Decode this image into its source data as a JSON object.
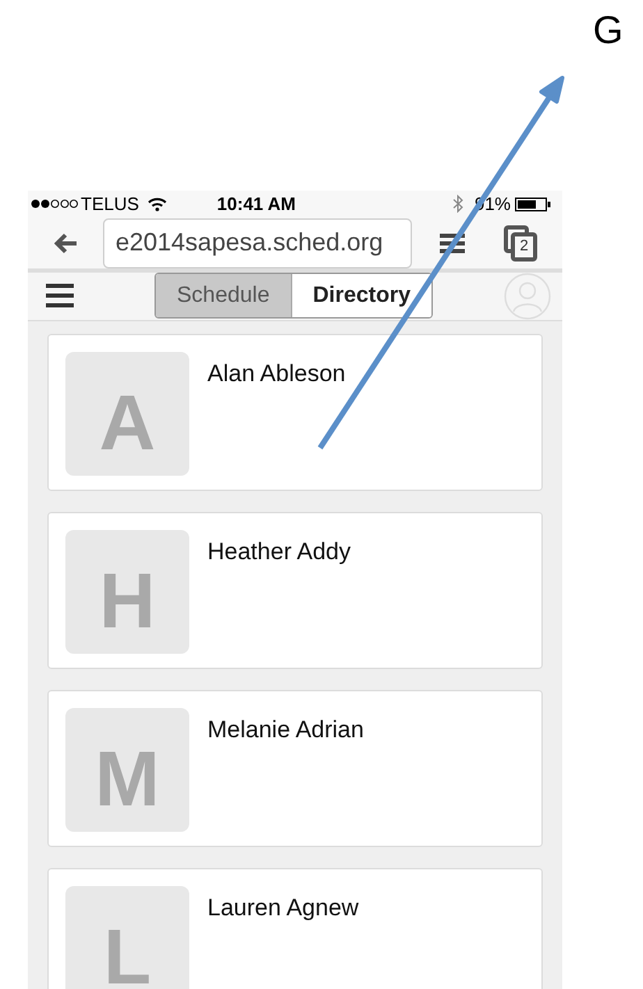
{
  "annotation": {
    "label": "G"
  },
  "status_bar": {
    "carrier": "TELUS",
    "time": "10:41 AM",
    "battery": "91%"
  },
  "browser": {
    "url": "e2014sapesa.sched.org",
    "tab_count": "2"
  },
  "header": {
    "tabs": [
      {
        "label": "Schedule",
        "selected": false
      },
      {
        "label": "Directory",
        "selected": true
      }
    ]
  },
  "people": [
    {
      "initial": "A",
      "name": "Alan Ableson"
    },
    {
      "initial": "H",
      "name": "Heather Addy"
    },
    {
      "initial": "M",
      "name": "Melanie Adrian"
    },
    {
      "initial": "L",
      "name": "Lauren Agnew"
    }
  ]
}
